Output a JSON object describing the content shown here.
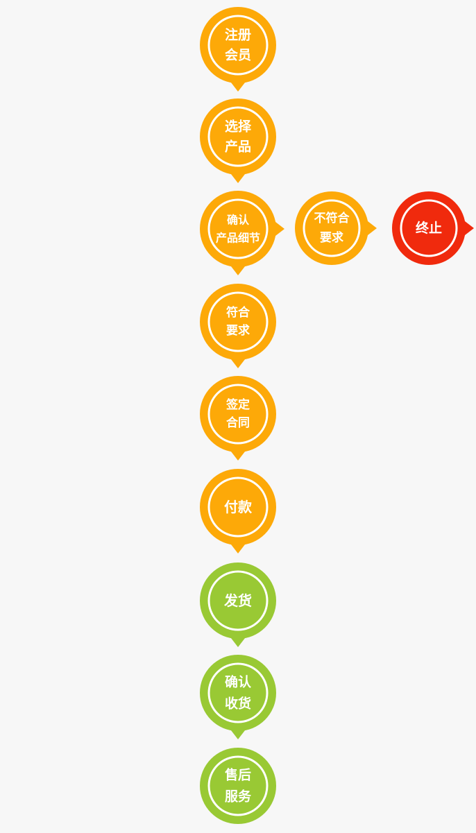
{
  "colors": {
    "background": "#f7f7f7",
    "orange": "#fda908",
    "green": "#99c934",
    "red": "#f02a0d",
    "ring": "#ffffff",
    "text": "#ffffff"
  },
  "nodes": [
    {
      "id": "register",
      "lines": [
        "注册",
        "会员"
      ],
      "color": "orange",
      "pointer": "down"
    },
    {
      "id": "select-product",
      "lines": [
        "选择",
        "产品"
      ],
      "color": "orange",
      "pointer": "down"
    },
    {
      "id": "confirm-details",
      "lines": [
        "确认",
        "产品细节"
      ],
      "color": "orange",
      "pointer": "both"
    },
    {
      "id": "meets-req",
      "lines": [
        "符合",
        "要求"
      ],
      "color": "orange",
      "pointer": "down"
    },
    {
      "id": "sign-contract",
      "lines": [
        "签定",
        "合同"
      ],
      "color": "orange",
      "pointer": "down"
    },
    {
      "id": "payment",
      "lines": [
        "付款"
      ],
      "color": "orange",
      "pointer": "down"
    },
    {
      "id": "shipping",
      "lines": [
        "发货"
      ],
      "color": "green",
      "pointer": "down"
    },
    {
      "id": "confirm-receipt",
      "lines": [
        "确认",
        "收货"
      ],
      "color": "green",
      "pointer": "down"
    },
    {
      "id": "after-sales",
      "lines": [
        "售后",
        "服务"
      ],
      "color": "green",
      "pointer": "none"
    },
    {
      "id": "not-meet-req",
      "lines": [
        "不符合",
        "要求"
      ],
      "color": "orange",
      "pointer": "right"
    },
    {
      "id": "terminate",
      "lines": [
        "终止"
      ],
      "color": "red",
      "pointer": "right"
    }
  ]
}
